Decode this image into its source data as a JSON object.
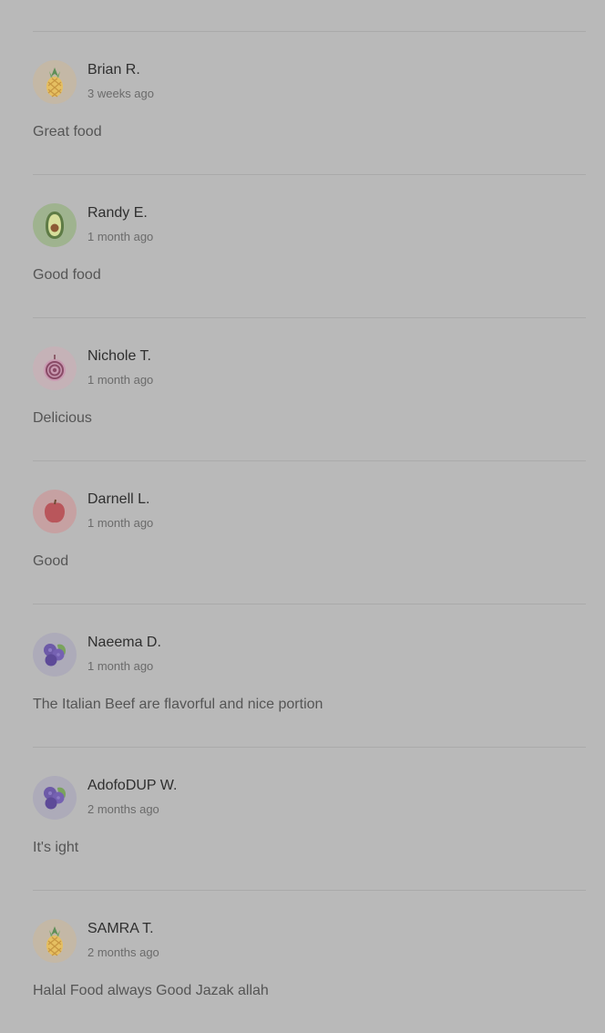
{
  "colors": {
    "page_background": "#b9b9b9",
    "divider": "#aaaaaa",
    "name_text": "#2f2f2f",
    "meta_text": "#6b6b6b",
    "body_text": "#555555"
  },
  "reviews": [
    {
      "name": "Brian R.",
      "time": "3 weeks ago",
      "text": "Great food",
      "avatar_icon": "pineapple-icon"
    },
    {
      "name": "Randy E.",
      "time": "1 month ago",
      "text": "Good food",
      "avatar_icon": "avocado-icon"
    },
    {
      "name": "Nichole T.",
      "time": "1 month ago",
      "text": "Delicious",
      "avatar_icon": "onion-icon"
    },
    {
      "name": "Darnell L.",
      "time": "1 month ago",
      "text": "Good",
      "avatar_icon": "apple-icon"
    },
    {
      "name": "Naeema D.",
      "time": "1 month ago",
      "text": "The Italian Beef are flavorful and nice portion",
      "avatar_icon": "blueberry-icon"
    },
    {
      "name": "AdofoDUP W.",
      "time": "2 months ago",
      "text": "It's ight",
      "avatar_icon": "blueberry-icon"
    },
    {
      "name": "SAMRA T.",
      "time": "2 months ago",
      "text": "Halal Food always Good Jazak allah",
      "avatar_icon": "pineapple-icon"
    }
  ]
}
